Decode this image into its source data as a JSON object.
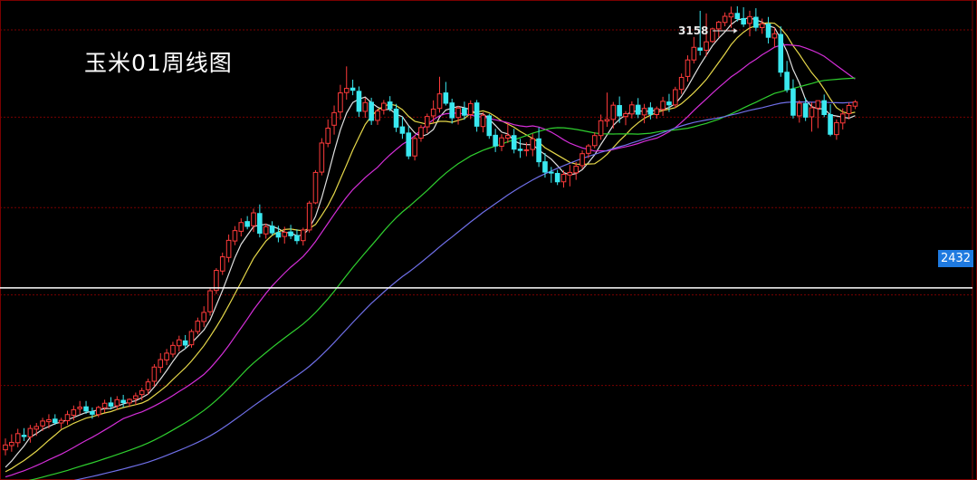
{
  "title": "玉米01周线图",
  "price_tag": "2432",
  "peak_label": "3158",
  "colors": {
    "background": "#000000",
    "up": "#ff3b3b",
    "down": "#3ae8f0",
    "grid": "#7a0000",
    "ma5": "#e0e0e0",
    "ma10": "#e6d84a",
    "ma20": "#d42ed8",
    "ma40": "#2fd02f",
    "ma60": "#6f6fe8",
    "hline": "#ffffff",
    "tag": "#1f7ae0"
  },
  "chart_data": {
    "type": "candlestick",
    "period": "weekly",
    "ylim": [
      1860,
      3300
    ],
    "grid_levels": [
      3230,
      2960,
      2680,
      2410,
      2130
    ],
    "horizontal_line": 2432,
    "max_marker": 3158,
    "candles": [
      [
        1931,
        1966,
        1914,
        1946
      ],
      [
        1944,
        1979,
        1925,
        1954
      ],
      [
        1953,
        1996,
        1939,
        1981
      ],
      [
        1976,
        1998,
        1958,
        1972
      ],
      [
        1971,
        2008,
        1953,
        1997
      ],
      [
        1995,
        2014,
        1974,
        2003
      ],
      [
        2005,
        2030,
        1989,
        2020
      ],
      [
        2018,
        2041,
        1997,
        2024
      ],
      [
        2026,
        2041,
        2008,
        2015
      ],
      [
        2014,
        2030,
        1996,
        2022
      ],
      [
        2021,
        2052,
        2008,
        2040
      ],
      [
        2038,
        2068,
        2022,
        2055
      ],
      [
        2058,
        2082,
        2042,
        2063
      ],
      [
        2064,
        2082,
        2042,
        2051
      ],
      [
        2049,
        2062,
        2027,
        2041
      ],
      [
        2040,
        2067,
        2032,
        2062
      ],
      [
        2061,
        2086,
        2046,
        2075
      ],
      [
        2076,
        2094,
        2056,
        2066
      ],
      [
        2067,
        2097,
        2054,
        2086
      ],
      [
        2084,
        2101,
        2062,
        2077
      ],
      [
        2076,
        2090,
        2063,
        2087
      ],
      [
        2089,
        2108,
        2070,
        2098
      ],
      [
        2102,
        2123,
        2084,
        2114
      ],
      [
        2117,
        2151,
        2101,
        2141
      ],
      [
        2143,
        2196,
        2127,
        2187
      ],
      [
        2186,
        2230,
        2169,
        2210
      ],
      [
        2209,
        2243,
        2193,
        2230
      ],
      [
        2227,
        2265,
        2217,
        2254
      ],
      [
        2253,
        2284,
        2235,
        2271
      ],
      [
        2268,
        2286,
        2243,
        2255
      ],
      [
        2256,
        2304,
        2247,
        2297
      ],
      [
        2297,
        2340,
        2288,
        2329
      ],
      [
        2328,
        2375,
        2311,
        2356
      ],
      [
        2358,
        2433,
        2346,
        2423
      ],
      [
        2424,
        2493,
        2413,
        2486
      ],
      [
        2484,
        2541,
        2472,
        2528
      ],
      [
        2526,
        2597,
        2511,
        2579
      ],
      [
        2577,
        2623,
        2564,
        2609
      ],
      [
        2607,
        2647,
        2591,
        2634
      ],
      [
        2637,
        2654,
        2613,
        2622
      ],
      [
        2624,
        2677,
        2605,
        2664
      ],
      [
        2662,
        2690,
        2588,
        2601
      ],
      [
        2599,
        2631,
        2584,
        2621
      ],
      [
        2623,
        2638,
        2595,
        2602
      ],
      [
        2603,
        2624,
        2573,
        2589
      ],
      [
        2591,
        2621,
        2569,
        2604
      ],
      [
        2605,
        2627,
        2583,
        2593
      ],
      [
        2594,
        2613,
        2567,
        2578
      ],
      [
        2578,
        2618,
        2563,
        2611
      ],
      [
        2611,
        2701,
        2603,
        2694
      ],
      [
        2695,
        2796,
        2691,
        2789
      ],
      [
        2790,
        2895,
        2780,
        2880
      ],
      [
        2879,
        2953,
        2867,
        2926
      ],
      [
        2935,
        2996,
        2906,
        2974
      ],
      [
        2976,
        3060,
        2952,
        3035
      ],
      [
        3036,
        3117,
        3014,
        3049
      ],
      [
        3050,
        3076,
        3028,
        3043
      ],
      [
        3040,
        3055,
        2961,
        2978
      ],
      [
        2978,
        3020,
        2958,
        3005
      ],
      [
        3006,
        3020,
        2936,
        2950
      ],
      [
        2950,
        2986,
        2936,
        2979
      ],
      [
        2982,
        3013,
        2968,
        3003
      ],
      [
        3007,
        3025,
        2978,
        2986
      ],
      [
        2985,
        3001,
        2914,
        2929
      ],
      [
        2930,
        2962,
        2893,
        2910
      ],
      [
        2911,
        2933,
        2830,
        2840
      ],
      [
        2840,
        2902,
        2826,
        2894
      ],
      [
        2895,
        2936,
        2884,
        2928
      ],
      [
        2930,
        2971,
        2911,
        2962
      ],
      [
        2964,
        3012,
        2941,
        2985
      ],
      [
        2987,
        3085,
        2974,
        3032
      ],
      [
        3035,
        3069,
        2996,
        3003
      ],
      [
        3004,
        3017,
        2940,
        2958
      ],
      [
        2959,
        2995,
        2937,
        2988
      ],
      [
        2987,
        3008,
        2952,
        2966
      ],
      [
        2968,
        3012,
        2954,
        3002
      ],
      [
        3004,
        3013,
        2915,
        2932
      ],
      [
        2931,
        2975,
        2913,
        2966
      ],
      [
        2964,
        2970,
        2893,
        2903
      ],
      [
        2904,
        2924,
        2852,
        2871
      ],
      [
        2870,
        2907,
        2855,
        2896
      ],
      [
        2895,
        2943,
        2880,
        2904
      ],
      [
        2903,
        2924,
        2848,
        2861
      ],
      [
        2861,
        2893,
        2834,
        2857
      ],
      [
        2858,
        2882,
        2839,
        2859
      ],
      [
        2860,
        2909,
        2839,
        2893
      ],
      [
        2893,
        2928,
        2806,
        2822
      ],
      [
        2822,
        2849,
        2773,
        2790
      ],
      [
        2790,
        2806,
        2757,
        2787
      ],
      [
        2786,
        2797,
        2750,
        2760
      ],
      [
        2760,
        2795,
        2742,
        2783
      ],
      [
        2781,
        2812,
        2746,
        2789
      ],
      [
        2788,
        2821,
        2766,
        2808
      ],
      [
        2810,
        2857,
        2800,
        2847
      ],
      [
        2848,
        2877,
        2833,
        2871
      ],
      [
        2872,
        2913,
        2864,
        2903
      ],
      [
        2903,
        2968,
        2890,
        2949
      ],
      [
        2948,
        3036,
        2930,
        2953
      ],
      [
        2953,
        3007,
        2925,
        2997
      ],
      [
        2996,
        3024,
        2942,
        2964
      ],
      [
        2962,
        2979,
        2935,
        2971
      ],
      [
        2970,
        3009,
        2956,
        2998
      ],
      [
        2997,
        3019,
        2957,
        2969
      ],
      [
        2967,
        3001,
        2941,
        2987
      ],
      [
        2989,
        3006,
        2953,
        2969
      ],
      [
        2968,
        2993,
        2955,
        2986
      ],
      [
        2984,
        3023,
        2964,
        3009
      ],
      [
        3007,
        3032,
        2976,
        2998
      ],
      [
        2998,
        3054,
        2989,
        3045
      ],
      [
        3046,
        3095,
        3032,
        3083
      ],
      [
        3086,
        3151,
        3070,
        3137
      ],
      [
        3137,
        3208,
        3126,
        3176
      ],
      [
        3174,
        3289,
        3151,
        3167
      ],
      [
        3167,
        3281,
        3148,
        3193
      ],
      [
        3194,
        3237,
        3190,
        3233
      ],
      [
        3233,
        3258,
        3207,
        3254
      ],
      [
        3253,
        3284,
        3241,
        3272
      ],
      [
        3270,
        3302,
        3236,
        3281
      ],
      [
        3281,
        3303,
        3256,
        3265
      ],
      [
        3265,
        3300,
        3239,
        3248
      ],
      [
        3250,
        3289,
        3210,
        3271
      ],
      [
        3269,
        3297,
        3226,
        3238
      ],
      [
        3237,
        3265,
        3218,
        3249
      ],
      [
        3248,
        3270,
        3188,
        3207
      ],
      [
        3205,
        3237,
        3176,
        3218
      ],
      [
        3216,
        3241,
        3085,
        3099
      ],
      [
        3099,
        3134,
        3036,
        3045
      ],
      [
        3047,
        3077,
        2956,
        2966
      ],
      [
        2964,
        3012,
        2943,
        3003
      ],
      [
        3002,
        3020,
        2948,
        2960
      ],
      [
        2961,
        3006,
        2915,
        2989
      ],
      [
        2988,
        3011,
        2926,
        3011
      ],
      [
        3011,
        3030,
        2960,
        2968
      ],
      [
        2968,
        3000,
        2901,
        2907
      ],
      [
        2906,
        2953,
        2890,
        2943
      ],
      [
        2942,
        2987,
        2922,
        2970
      ],
      [
        2971,
        3005,
        2953,
        2996
      ],
      [
        2994,
        3013,
        2985,
        3007
      ]
    ],
    "moving_averages": [
      {
        "period": 5,
        "color": "#e0e0e0"
      },
      {
        "period": 10,
        "color": "#e6d84a"
      },
      {
        "period": 20,
        "color": "#d42ed8"
      },
      {
        "period": 40,
        "color": "#2fd02f"
      },
      {
        "period": 60,
        "color": "#6f6fe8"
      }
    ]
  }
}
